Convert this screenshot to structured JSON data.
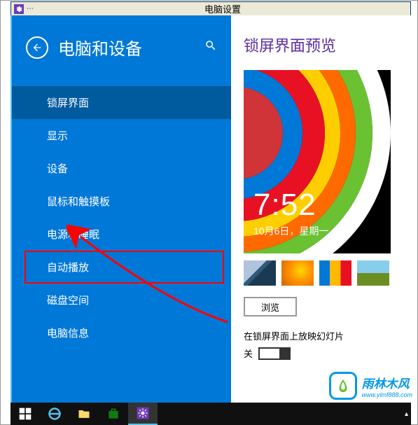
{
  "titlebar": {
    "title": "电脑设置"
  },
  "sidebar": {
    "header_title": "电脑和设备",
    "items": [
      {
        "label": "锁屏界面",
        "selected": true
      },
      {
        "label": "显示"
      },
      {
        "label": "设备"
      },
      {
        "label": "鼠标和触摸板"
      },
      {
        "label": "电源和睡眠"
      },
      {
        "label": "自动播放",
        "highlighted": true
      },
      {
        "label": "磁盘空间"
      },
      {
        "label": "电脑信息"
      }
    ]
  },
  "content": {
    "title": "锁屏界面预览",
    "preview_time": "7:52",
    "preview_date": "10月6日，星期一",
    "browse_label": "浏览",
    "slideshow_label": "在锁屏界面上放映幻灯片",
    "toggle_state": "关"
  },
  "watermark": {
    "cn": "雨林木风",
    "url": "www.ylmf888.com"
  }
}
